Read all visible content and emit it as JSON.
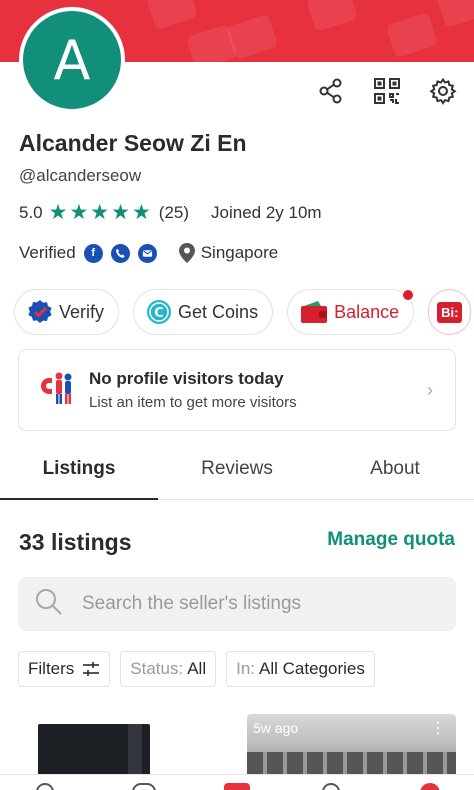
{
  "profile": {
    "avatar_letter": "A",
    "name": "Alcander Seow Zi En",
    "handle": "@alcanderseow",
    "rating": "5.0",
    "rating_count": "(25)",
    "stars": 5,
    "joined": "Joined 2y 10m",
    "verified_label": "Verified",
    "location": "Singapore"
  },
  "header_actions": [
    "share-icon",
    "qr-code-icon",
    "settings-icon"
  ],
  "chips": {
    "verify": "Verify",
    "get_coins": "Get Coins",
    "balance": "Balance",
    "partial": "Bi:"
  },
  "visitors": {
    "title": "No profile visitors today",
    "subtitle": "List an item to get more visitors"
  },
  "tabs": [
    {
      "label": "Listings",
      "active": true
    },
    {
      "label": "Reviews",
      "active": false
    },
    {
      "label": "About",
      "active": false
    }
  ],
  "listings": {
    "count_label": "33 listings",
    "manage_quota": "Manage quota",
    "search_placeholder": "Search the seller's listings"
  },
  "filters": {
    "filters_label": "Filters",
    "status_prefix": "Status:",
    "status_value": "All",
    "in_prefix": "In:",
    "in_value": "All Categories"
  },
  "cards": [
    {
      "age": ""
    },
    {
      "age": "5w ago"
    }
  ],
  "colors": {
    "brand_red": "#e8313f",
    "accent_green": "#118f78",
    "balance_red": "#d6202f"
  }
}
